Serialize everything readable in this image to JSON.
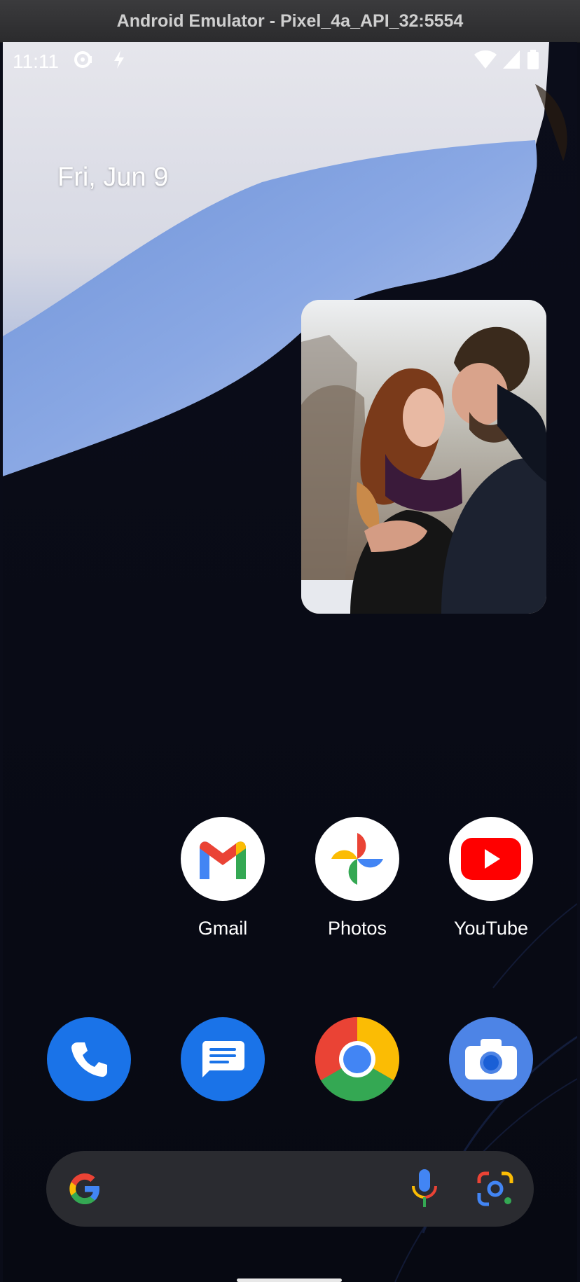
{
  "window": {
    "title": "Android Emulator - Pixel_4a_API_32:5554"
  },
  "status_bar": {
    "time": "11:11"
  },
  "home": {
    "date": "Fri, Jun 9",
    "apps": [
      {
        "name": "gmail",
        "label": "Gmail"
      },
      {
        "name": "photos",
        "label": "Photos"
      },
      {
        "name": "youtube",
        "label": "YouTube"
      }
    ],
    "dock": [
      "phone",
      "messages",
      "chrome",
      "camera"
    ]
  },
  "colors": {
    "youtube_red": "#ff0000",
    "google_blue": "#4285f4",
    "google_red": "#ea4335",
    "google_yellow": "#fbbc04",
    "google_green": "#34a853",
    "dock_blue": "#1a73e8",
    "search_bg": "#2a2b30"
  }
}
